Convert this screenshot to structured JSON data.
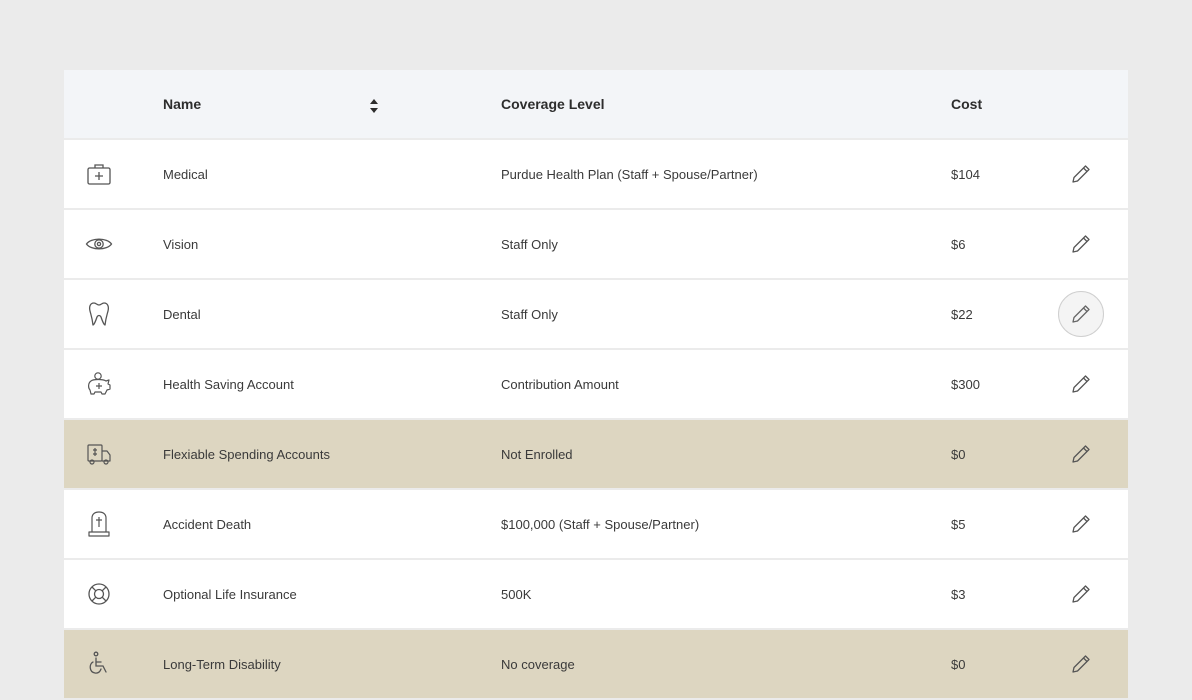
{
  "header": {
    "name": "Name",
    "coverage": "Coverage  Level",
    "cost": "Cost"
  },
  "rows": [
    {
      "icon": "medical-kit-icon",
      "name": "Medical",
      "coverage": "Purdue Health Plan (Staff + Spouse/Partner)",
      "cost": "$104"
    },
    {
      "icon": "eye-icon",
      "name": "Vision",
      "coverage": "Staff  Only",
      "cost": "$6"
    },
    {
      "icon": "tooth-icon",
      "name": "Dental",
      "coverage": "Staff Only",
      "cost": "$22"
    },
    {
      "icon": "piggy-bank-icon",
      "name": "Health Saving Account",
      "coverage": "Contribution Amount",
      "cost": "$300"
    },
    {
      "icon": "spending-account-icon",
      "name": "Flexiable Spending Accounts",
      "coverage": "Not Enrolled",
      "cost": "$0"
    },
    {
      "icon": "tombstone-icon",
      "name": "Accident Death",
      "coverage": "$100,000 (Staff + Spouse/Partner)",
      "cost": "$5"
    },
    {
      "icon": "life-ring-icon",
      "name": "Optional Life Insurance",
      "coverage": "500K",
      "cost": "$3"
    },
    {
      "icon": "wheelchair-icon",
      "name": "Long-Term Disability",
      "coverage": "No coverage",
      "cost": "$0"
    }
  ],
  "colors": {
    "background": "#ebebeb",
    "header": "#f3f5f8",
    "row": "#ffffff",
    "not_enrolled_row": "#ddd6c1"
  }
}
